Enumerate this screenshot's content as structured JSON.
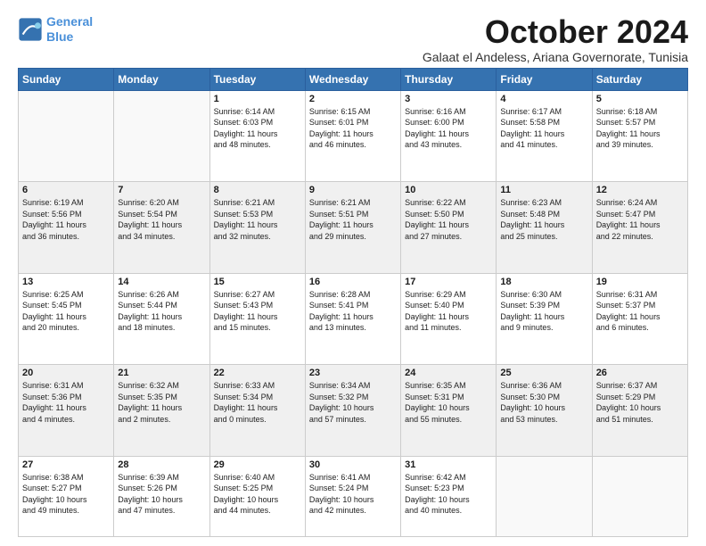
{
  "logo": {
    "line1": "General",
    "line2": "Blue"
  },
  "title": "October 2024",
  "subtitle": "Galaat el Andeless, Ariana Governorate, Tunisia",
  "days_of_week": [
    "Sunday",
    "Monday",
    "Tuesday",
    "Wednesday",
    "Thursday",
    "Friday",
    "Saturday"
  ],
  "weeks": [
    [
      {
        "num": "",
        "info": ""
      },
      {
        "num": "",
        "info": ""
      },
      {
        "num": "1",
        "info": "Sunrise: 6:14 AM\nSunset: 6:03 PM\nDaylight: 11 hours\nand 48 minutes."
      },
      {
        "num": "2",
        "info": "Sunrise: 6:15 AM\nSunset: 6:01 PM\nDaylight: 11 hours\nand 46 minutes."
      },
      {
        "num": "3",
        "info": "Sunrise: 6:16 AM\nSunset: 6:00 PM\nDaylight: 11 hours\nand 43 minutes."
      },
      {
        "num": "4",
        "info": "Sunrise: 6:17 AM\nSunset: 5:58 PM\nDaylight: 11 hours\nand 41 minutes."
      },
      {
        "num": "5",
        "info": "Sunrise: 6:18 AM\nSunset: 5:57 PM\nDaylight: 11 hours\nand 39 minutes."
      }
    ],
    [
      {
        "num": "6",
        "info": "Sunrise: 6:19 AM\nSunset: 5:56 PM\nDaylight: 11 hours\nand 36 minutes."
      },
      {
        "num": "7",
        "info": "Sunrise: 6:20 AM\nSunset: 5:54 PM\nDaylight: 11 hours\nand 34 minutes."
      },
      {
        "num": "8",
        "info": "Sunrise: 6:21 AM\nSunset: 5:53 PM\nDaylight: 11 hours\nand 32 minutes."
      },
      {
        "num": "9",
        "info": "Sunrise: 6:21 AM\nSunset: 5:51 PM\nDaylight: 11 hours\nand 29 minutes."
      },
      {
        "num": "10",
        "info": "Sunrise: 6:22 AM\nSunset: 5:50 PM\nDaylight: 11 hours\nand 27 minutes."
      },
      {
        "num": "11",
        "info": "Sunrise: 6:23 AM\nSunset: 5:48 PM\nDaylight: 11 hours\nand 25 minutes."
      },
      {
        "num": "12",
        "info": "Sunrise: 6:24 AM\nSunset: 5:47 PM\nDaylight: 11 hours\nand 22 minutes."
      }
    ],
    [
      {
        "num": "13",
        "info": "Sunrise: 6:25 AM\nSunset: 5:45 PM\nDaylight: 11 hours\nand 20 minutes."
      },
      {
        "num": "14",
        "info": "Sunrise: 6:26 AM\nSunset: 5:44 PM\nDaylight: 11 hours\nand 18 minutes."
      },
      {
        "num": "15",
        "info": "Sunrise: 6:27 AM\nSunset: 5:43 PM\nDaylight: 11 hours\nand 15 minutes."
      },
      {
        "num": "16",
        "info": "Sunrise: 6:28 AM\nSunset: 5:41 PM\nDaylight: 11 hours\nand 13 minutes."
      },
      {
        "num": "17",
        "info": "Sunrise: 6:29 AM\nSunset: 5:40 PM\nDaylight: 11 hours\nand 11 minutes."
      },
      {
        "num": "18",
        "info": "Sunrise: 6:30 AM\nSunset: 5:39 PM\nDaylight: 11 hours\nand 9 minutes."
      },
      {
        "num": "19",
        "info": "Sunrise: 6:31 AM\nSunset: 5:37 PM\nDaylight: 11 hours\nand 6 minutes."
      }
    ],
    [
      {
        "num": "20",
        "info": "Sunrise: 6:31 AM\nSunset: 5:36 PM\nDaylight: 11 hours\nand 4 minutes."
      },
      {
        "num": "21",
        "info": "Sunrise: 6:32 AM\nSunset: 5:35 PM\nDaylight: 11 hours\nand 2 minutes."
      },
      {
        "num": "22",
        "info": "Sunrise: 6:33 AM\nSunset: 5:34 PM\nDaylight: 11 hours\nand 0 minutes."
      },
      {
        "num": "23",
        "info": "Sunrise: 6:34 AM\nSunset: 5:32 PM\nDaylight: 10 hours\nand 57 minutes."
      },
      {
        "num": "24",
        "info": "Sunrise: 6:35 AM\nSunset: 5:31 PM\nDaylight: 10 hours\nand 55 minutes."
      },
      {
        "num": "25",
        "info": "Sunrise: 6:36 AM\nSunset: 5:30 PM\nDaylight: 10 hours\nand 53 minutes."
      },
      {
        "num": "26",
        "info": "Sunrise: 6:37 AM\nSunset: 5:29 PM\nDaylight: 10 hours\nand 51 minutes."
      }
    ],
    [
      {
        "num": "27",
        "info": "Sunrise: 6:38 AM\nSunset: 5:27 PM\nDaylight: 10 hours\nand 49 minutes."
      },
      {
        "num": "28",
        "info": "Sunrise: 6:39 AM\nSunset: 5:26 PM\nDaylight: 10 hours\nand 47 minutes."
      },
      {
        "num": "29",
        "info": "Sunrise: 6:40 AM\nSunset: 5:25 PM\nDaylight: 10 hours\nand 44 minutes."
      },
      {
        "num": "30",
        "info": "Sunrise: 6:41 AM\nSunset: 5:24 PM\nDaylight: 10 hours\nand 42 minutes."
      },
      {
        "num": "31",
        "info": "Sunrise: 6:42 AM\nSunset: 5:23 PM\nDaylight: 10 hours\nand 40 minutes."
      },
      {
        "num": "",
        "info": ""
      },
      {
        "num": "",
        "info": ""
      }
    ]
  ]
}
